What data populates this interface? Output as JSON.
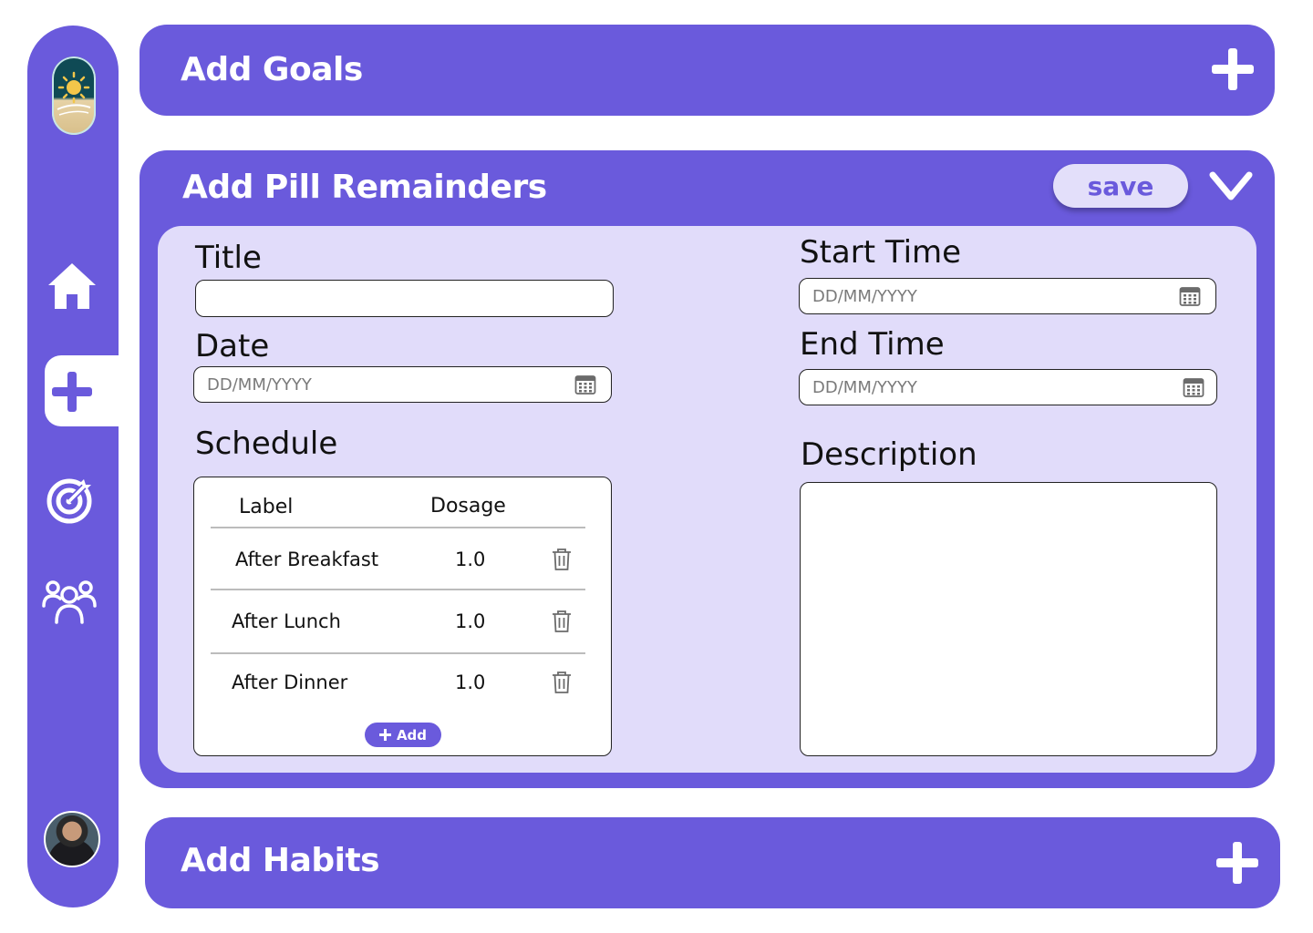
{
  "sidebar": {
    "logo_icon": "sun-pill-logo-icon",
    "nav": [
      {
        "icon": "home-icon"
      },
      {
        "icon": "plus-icon",
        "active": true
      },
      {
        "icon": "target-icon"
      },
      {
        "icon": "people-icon"
      }
    ],
    "avatar_icon": "user-avatar"
  },
  "goals_panel": {
    "title": "Add Goals"
  },
  "pill_panel": {
    "title": "Add Pill Remainders",
    "save_label": "save",
    "form": {
      "title_label": "Title",
      "title_value": "",
      "date_label": "Date",
      "date_placeholder": "DD/MM/YYYY",
      "start_label": "Start Time",
      "start_placeholder": "DD/MM/YYYY",
      "end_label": "End Time",
      "end_placeholder": "DD/MM/YYYY",
      "schedule_label": "Schedule",
      "description_label": "Description",
      "description_value": ""
    },
    "schedule": {
      "headers": {
        "label": "Label",
        "dosage": "Dosage"
      },
      "rows": [
        {
          "label": "After Breakfast",
          "dosage": "1.0"
        },
        {
          "label": "After Lunch",
          "dosage": "1.0"
        },
        {
          "label": "After Dinner",
          "dosage": "1.0"
        }
      ],
      "add_label": "Add"
    }
  },
  "habits_panel": {
    "title": "Add Habits"
  },
  "colors": {
    "primary": "#6a5adc",
    "panel_light": "#e1dcfa",
    "save_bg": "#e3dffa"
  }
}
